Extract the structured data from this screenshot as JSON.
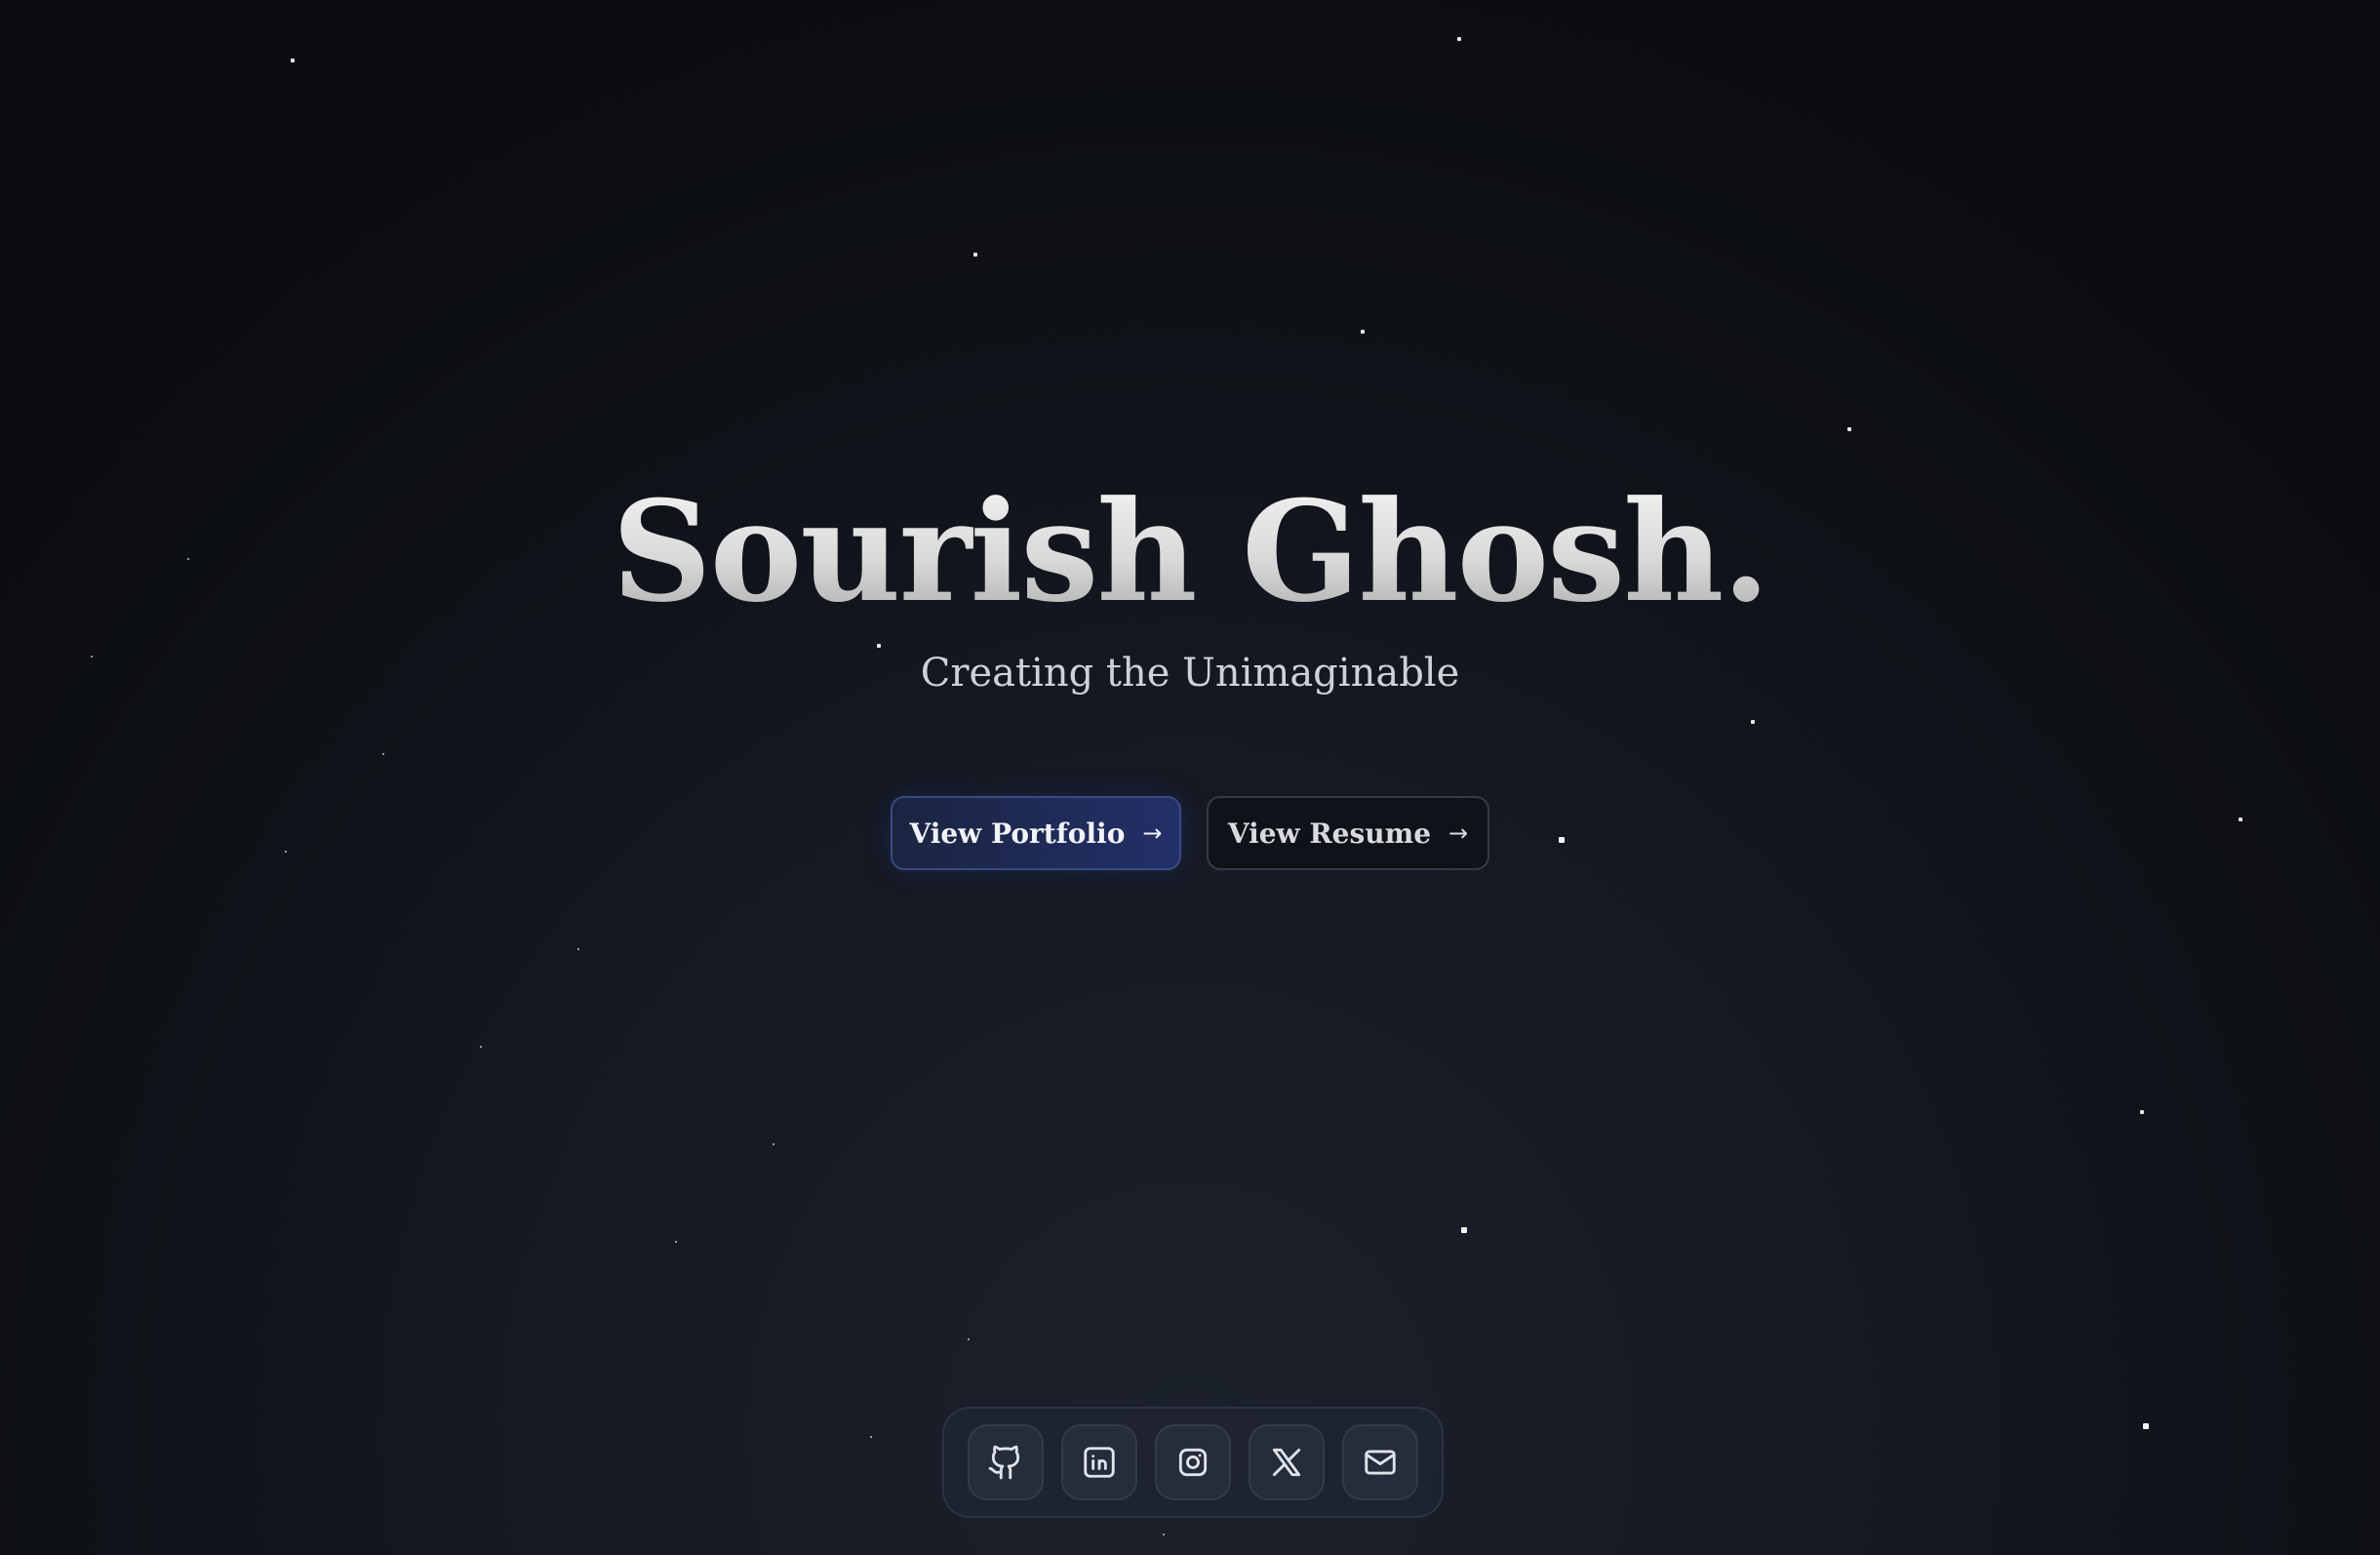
{
  "hero": {
    "title": "Sourish Ghosh.",
    "subtitle": "Creating the Unimaginable"
  },
  "actions": {
    "portfolio_label": "View Portfolio",
    "resume_label": "View Resume",
    "arrow": "→"
  },
  "social": {
    "items": [
      {
        "icon": "github-icon"
      },
      {
        "icon": "linkedin-icon"
      },
      {
        "icon": "instagram-icon"
      },
      {
        "icon": "x-twitter-icon"
      },
      {
        "icon": "mail-icon"
      }
    ]
  },
  "colors": {
    "background": "#0e1116",
    "primary_button": "#223069",
    "title_text": "#d9d9d9",
    "subtitle_text": "#cfd1d6"
  }
}
